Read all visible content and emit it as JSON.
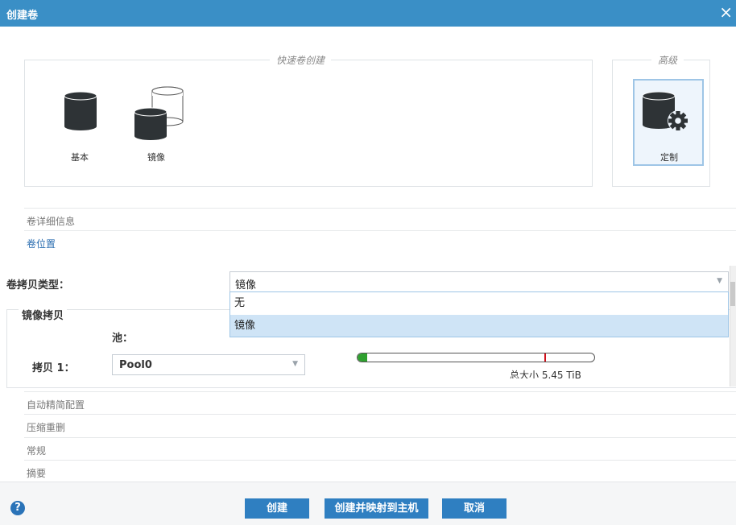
{
  "window": {
    "title": "创建卷",
    "close_glyph": "×"
  },
  "quick_create": {
    "legend": "快速卷创建",
    "options": [
      {
        "label": "基本",
        "icon": "single-disk-icon"
      },
      {
        "label": "镜像",
        "icon": "mirrored-disks-icon"
      }
    ]
  },
  "advanced": {
    "legend": "高级",
    "option": {
      "label": "定制",
      "icon": "disk-gear-icon",
      "selected": true
    }
  },
  "sections": {
    "details": "卷详细信息",
    "location": "卷位置",
    "thin": "自动精简配置",
    "dedup": "压缩重删",
    "general": "常规",
    "summary": "摘要"
  },
  "copy_type": {
    "label": "卷拷贝类型：",
    "value": "镜像",
    "options": [
      "无",
      "镜像"
    ],
    "highlighted": "镜像"
  },
  "mirror_copy": {
    "title": "镜像拷贝",
    "pool_header": "池：",
    "copy1_label": "拷贝 1：",
    "pool_value": "Pool0",
    "capacity_text": "总大小 5.45 TiB",
    "used_fraction": 0.04,
    "marker_fraction": 0.79
  },
  "footer": {
    "help": "?",
    "create": "创建",
    "create_map": "创建并映射到主机",
    "cancel": "取消"
  },
  "colors": {
    "accent": "#3a8fc6",
    "button": "#2f7fc1",
    "capacity_used": "#2fa02f",
    "capacity_marker": "#d0101a"
  }
}
